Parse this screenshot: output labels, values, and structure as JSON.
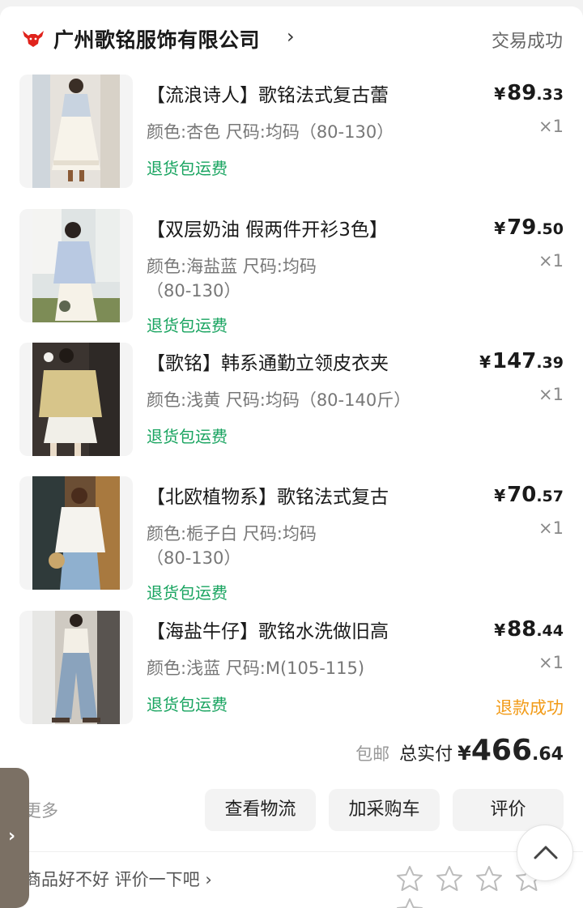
{
  "shop": {
    "name": "广州歌铭服饰有限公司",
    "chevron": "›",
    "status": "交易成功",
    "logo_icon": "red-bull-logo-icon"
  },
  "items": [
    {
      "title": "【流浪诗人】歌铭法式复古蕾",
      "spec": "颜色:杏色 尺码:均码（80-130）",
      "tag": "退货包运费",
      "price_currency": "¥",
      "price_int": "89",
      "price_dec": ".33",
      "qty": "×1",
      "refund": ""
    },
    {
      "title": "【双层奶油 假两件开衫3色】",
      "spec": "颜色:海盐蓝 尺码:均码（80-130）",
      "tag": "退货包运费",
      "price_currency": "¥",
      "price_int": "79",
      "price_dec": ".50",
      "qty": "×1",
      "refund": ""
    },
    {
      "title": "【歌铭】韩系通勤立领皮衣夹",
      "spec": "颜色:浅黄 尺码:均码（80-140斤）",
      "tag": "退货包运费",
      "price_currency": "¥",
      "price_int": "147",
      "price_dec": ".39",
      "qty": "×1",
      "refund": ""
    },
    {
      "title": "【北欧植物系】歌铭法式复古",
      "spec": "颜色:栀子白 尺码:均码（80-130）",
      "tag": "退货包运费",
      "price_currency": "¥",
      "price_int": "70",
      "price_dec": ".57",
      "qty": "×1",
      "refund": ""
    },
    {
      "title": "【海盐牛仔】歌铭水洗做旧高",
      "spec": "颜色:浅蓝 尺码:M(105-115)",
      "tag": "退货包运费",
      "price_currency": "¥",
      "price_int": "88",
      "price_dec": ".44",
      "qty": "×1",
      "refund": "退款成功"
    }
  ],
  "total": {
    "free_shipping": "包邮",
    "label": "总实付",
    "currency": "¥",
    "int": "466",
    "dec": ".64"
  },
  "actions": {
    "more": "更多",
    "logistics": "查看物流",
    "add_to_cart": "加采购车",
    "review": "评价"
  },
  "review_prompt": {
    "text": "商品好不好 评价一下吧 ›",
    "stars": 5,
    "rating": 0
  },
  "icons": {
    "side_handle": "chevron-right-icon",
    "scroll_top": "chevron-up-icon",
    "star": "star-outline-icon"
  },
  "colors": {
    "tag_green": "#19a460",
    "refund_orange": "#f29b17",
    "logo_red": "#e0231c"
  }
}
